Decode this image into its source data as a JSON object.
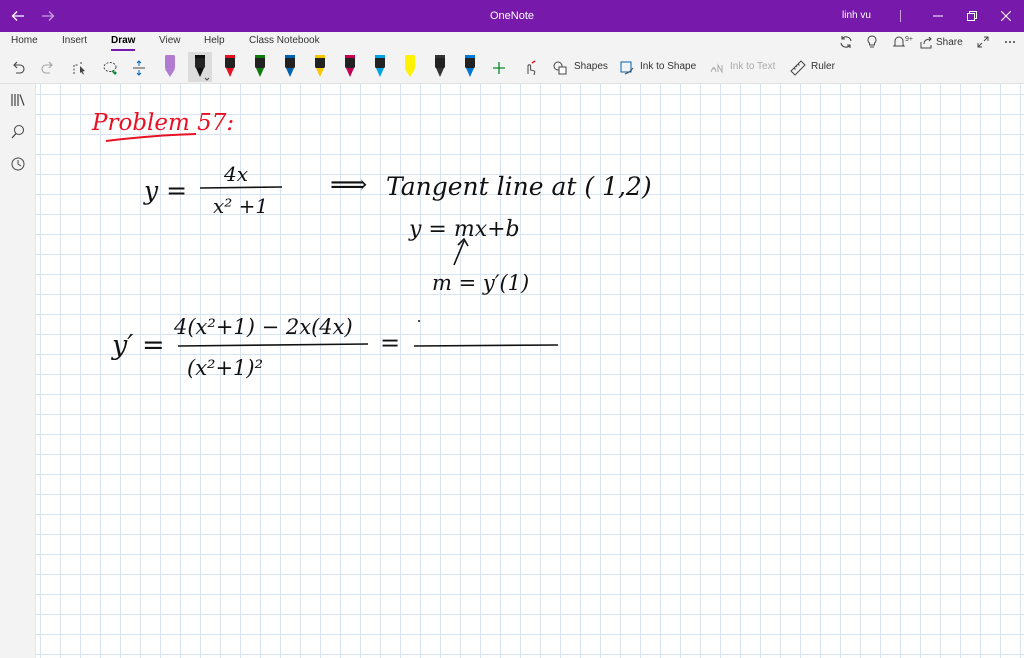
{
  "titlebar": {
    "app_title": "OneNote",
    "user_name": "linh vu",
    "icons": [
      "back-arrow-icon",
      "forward-arrow-icon",
      "minimize-icon",
      "restore-icon",
      "close-icon"
    ],
    "accent_color": "#7719aa"
  },
  "menu": {
    "tabs": [
      {
        "label": "Home"
      },
      {
        "label": "Insert"
      },
      {
        "label": "Draw"
      },
      {
        "label": "View"
      },
      {
        "label": "Help"
      },
      {
        "label": "Class Notebook"
      }
    ],
    "active_tab": "Draw",
    "share_label": "Share",
    "right_icons": [
      "sync-icon",
      "lightbulb-icon",
      "bell-icon",
      "share-icon",
      "expand-icon",
      "more-icon"
    ],
    "notification_count": "9+"
  },
  "ribbon": {
    "tools": [
      "undo-icon",
      "redo-icon",
      "lasso-select-icon",
      "lasso-icon",
      "add-space-icon"
    ],
    "pens": [
      {
        "color": "#b07bd0",
        "kind": "highlighter"
      },
      {
        "color": "#111111",
        "kind": "pen"
      },
      {
        "color": "#e81123",
        "kind": "pen"
      },
      {
        "color": "#107c10",
        "kind": "pen"
      },
      {
        "color": "#0063b1",
        "kind": "pen"
      },
      {
        "color": "#f7c600",
        "kind": "pen"
      },
      {
        "color": "#c30052",
        "kind": "pen"
      },
      {
        "color": "#00a2e8",
        "kind": "pen"
      },
      {
        "color": "#fff100",
        "kind": "highlighter"
      },
      {
        "color": "#333333",
        "kind": "pencil"
      },
      {
        "color": "#0078d7",
        "kind": "pen"
      }
    ],
    "add_pen_icon": "plus-icon",
    "shapes_label": "Shapes",
    "ink_to_shape_label": "Ink to Shape",
    "ink_to_text_label": "Ink to Text",
    "ruler_label": "Ruler"
  },
  "leftnav": {
    "icons": [
      "notebooks-icon",
      "search-icon",
      "recent-icon"
    ]
  },
  "page": {
    "ink_color_heading": "#e81123",
    "ink_color_body": "#111111",
    "heading": "Problem 57:",
    "line1_lhs": "y =",
    "line1_num": "4x",
    "line1_den": "x² +1",
    "line1_arrow": "⟹",
    "line1_text": "Tangent line  at  ( 1,2)",
    "line2": "y = mx+b",
    "line3": "m = y′(1)",
    "line4_lhs": "y′ =",
    "line4_num": "4(x²+1) − 2x(4x)",
    "line4_den": "(x²+1)²",
    "line4_eq": "="
  }
}
